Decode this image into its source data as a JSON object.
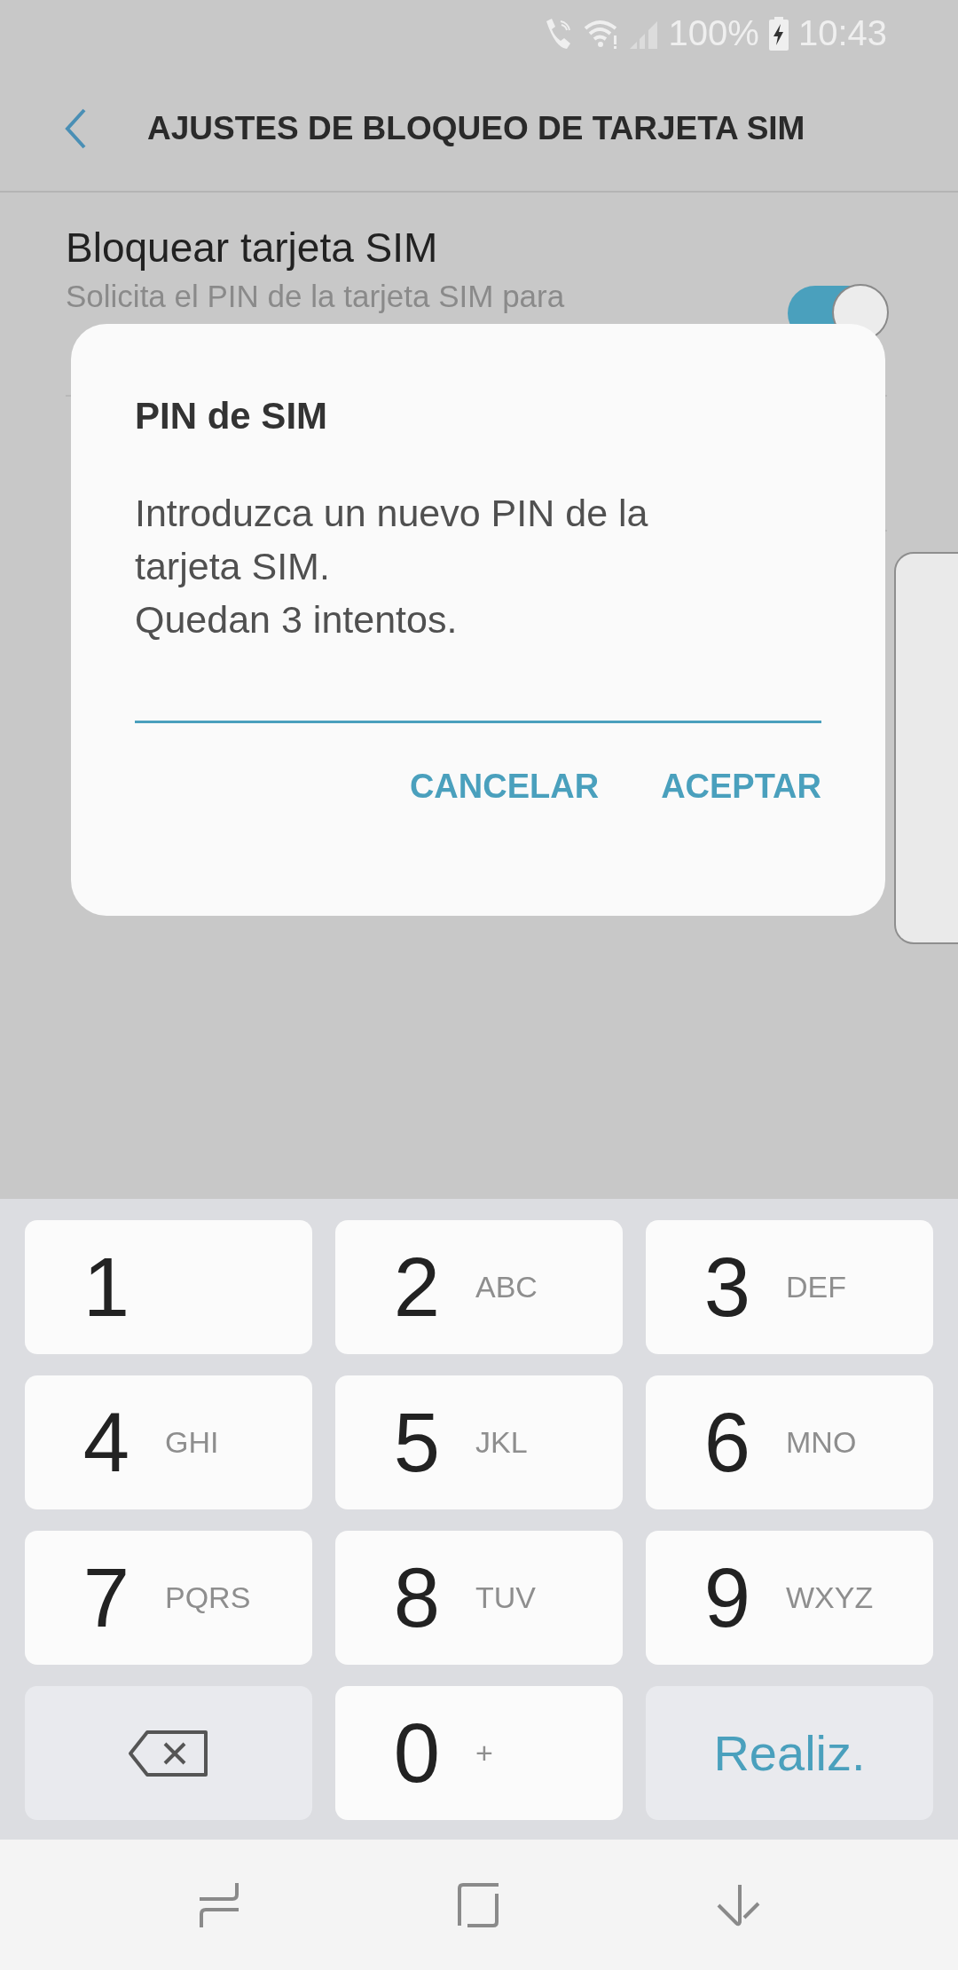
{
  "status_bar": {
    "battery": "100%",
    "time": "10:43"
  },
  "app_bar": {
    "title": "AJUSTES DE BLOQUEO DE TARJETA SIM"
  },
  "settings": [
    {
      "title": "Bloquear tarjeta SIM",
      "subtitle": "Solicita el PIN de la tarjeta SIM para",
      "on": true
    }
  ],
  "dialog": {
    "title": "PIN de SIM",
    "message": "Introduzca un nuevo PIN de la\ntarjeta SIM.\nQuedan 3 intentos.",
    "buttons": [
      "CANCELAR",
      "ACEPTAR"
    ]
  },
  "keypad": {
    "keys": [
      {
        "kind": "digit",
        "digit": "1"
      },
      {
        "kind": "digit",
        "digit": "2",
        "letters": "ABC"
      },
      {
        "kind": "digit",
        "digit": "3",
        "letters": "DEF"
      },
      {
        "kind": "digit",
        "digit": "4",
        "letters": "GHI"
      },
      {
        "kind": "digit",
        "digit": "5",
        "letters": "JKL"
      },
      {
        "kind": "digit",
        "digit": "6",
        "letters": "MNO"
      },
      {
        "kind": "digit",
        "digit": "7",
        "letters": "PQRS"
      },
      {
        "kind": "digit",
        "digit": "8",
        "letters": "TUV"
      },
      {
        "kind": "digit",
        "digit": "9",
        "letters": "WXYZ"
      },
      {
        "kind": "backspace"
      },
      {
        "kind": "digit",
        "digit": "0",
        "letters": "+"
      },
      {
        "kind": "action",
        "label": "Realiz."
      }
    ]
  }
}
